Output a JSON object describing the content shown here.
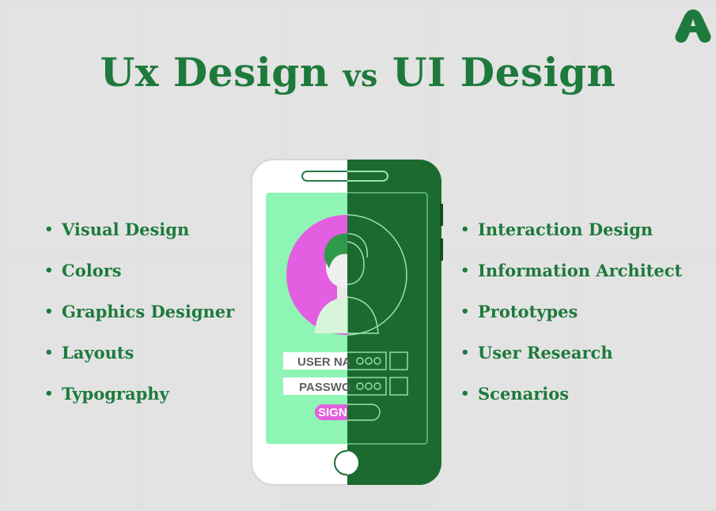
{
  "title": {
    "part1": "Ux Design",
    "vs": "vs",
    "part2": "UI Design"
  },
  "left_items": [
    "Visual Design",
    "Colors",
    "Graphics Designer",
    "Layouts",
    "Typography"
  ],
  "right_items": [
    "Interaction Design",
    "Information Architect",
    "Prototypes",
    "User Research",
    "Scenarios"
  ],
  "phone": {
    "username_label": "USER NA",
    "password_label": "PASSWO",
    "signin_label": "SIGN"
  },
  "colors": {
    "brand_green": "#1e7a3c",
    "dark_green": "#1b6b30",
    "light_green": "#8ff5b4",
    "magenta": "#e35ee0"
  },
  "icons": {
    "logo": "brand-logo-icon"
  }
}
